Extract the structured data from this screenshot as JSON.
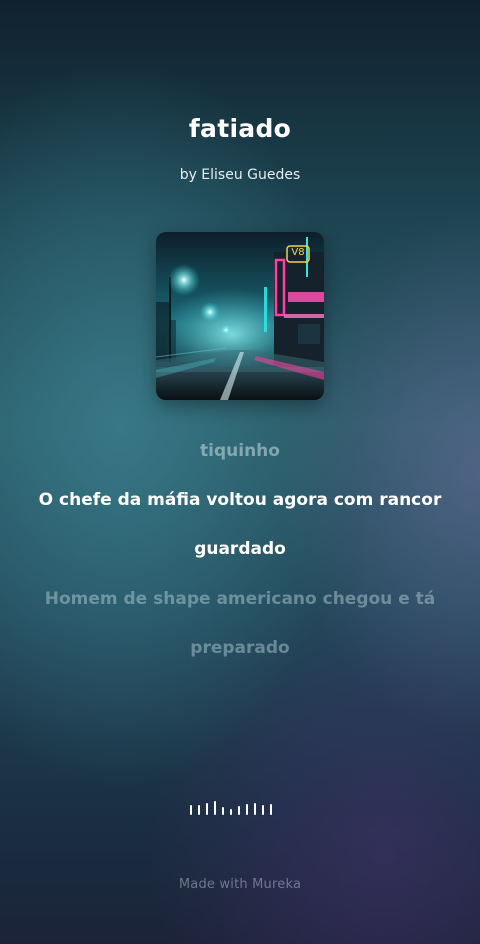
{
  "song": {
    "title": "fatiado",
    "artist": "by Eliseu Guedes"
  },
  "cover": {
    "icon": "neon-city-road-cover-art",
    "sign_text": "V8",
    "accent_colors": [
      "#ff3fa4",
      "#2ee6e0",
      "#f2d24a"
    ]
  },
  "lyrics": {
    "previous": "tiquinho",
    "current_line1": "O chefe da máfia voltou agora com rancor",
    "current_line2": "guardado",
    "next_line1": "Homem de shape americano chegou e tá",
    "next_line2": "preparado"
  },
  "player": {
    "indicator_icon": "audio-waveform-icon"
  },
  "footer": {
    "text": "Made with Mureka"
  }
}
